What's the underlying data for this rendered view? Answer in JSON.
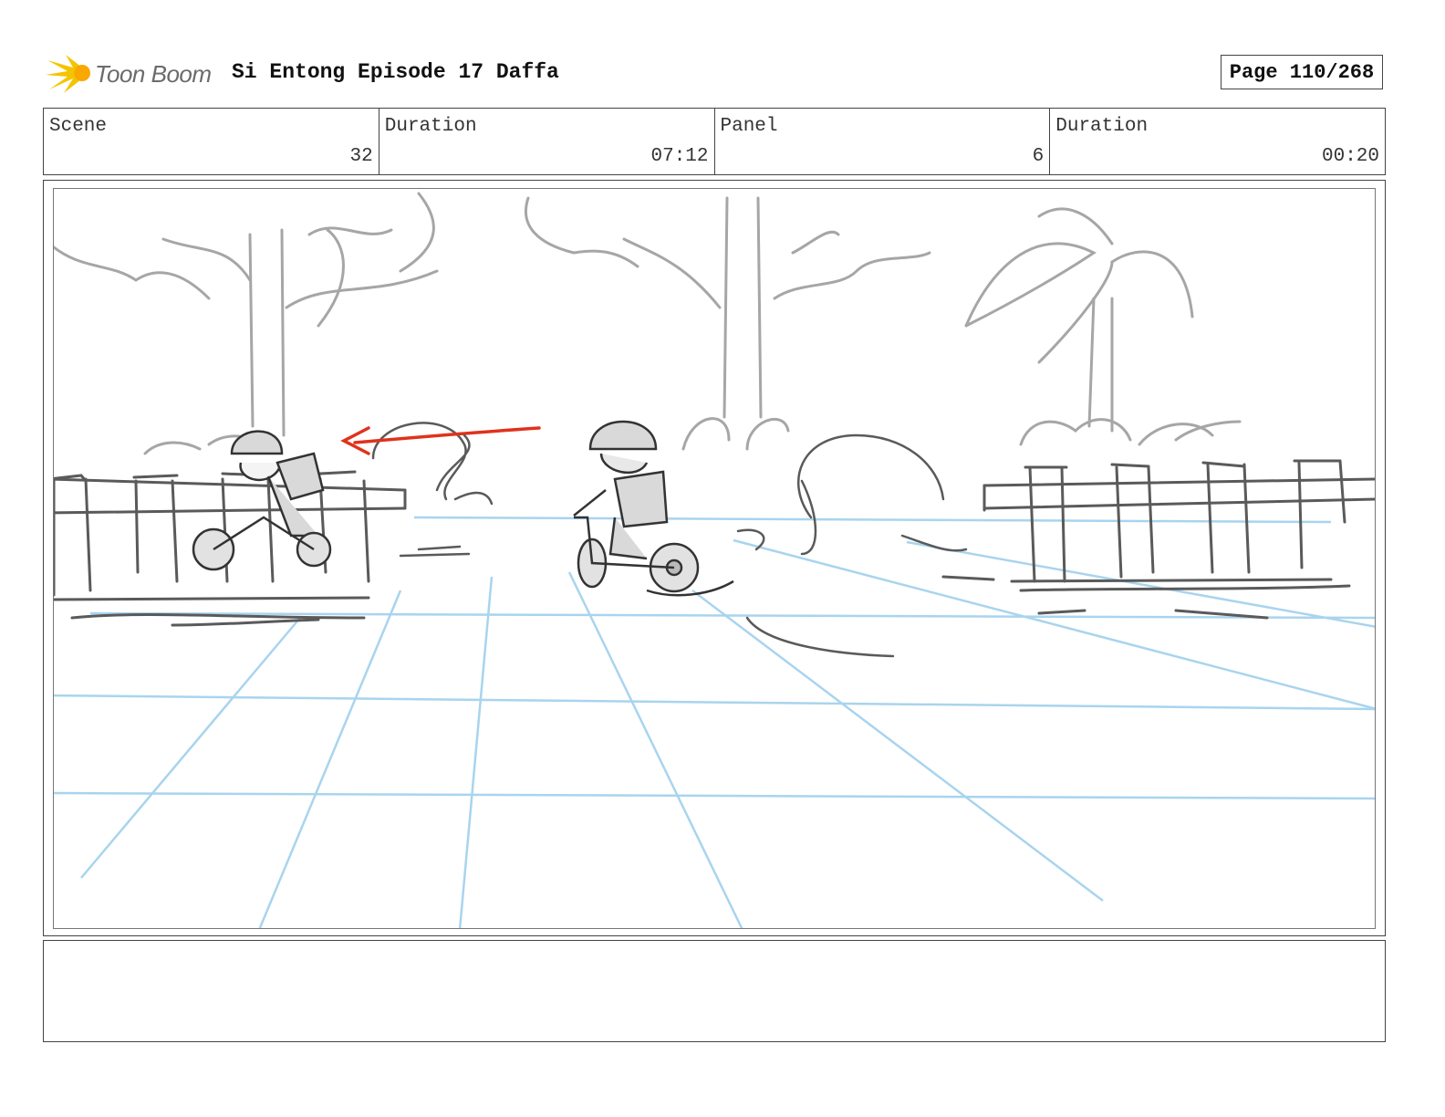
{
  "header": {
    "logo_text": "Toon Boom",
    "title": "Si Entong Episode 17 Daffa",
    "page": "Page 110/268"
  },
  "info": {
    "scene_label": "Scene",
    "scene_value": "32",
    "scene_duration_label": "Duration",
    "scene_duration_value": "07:12",
    "panel_label": "Panel",
    "panel_value": "6",
    "panel_duration_label": "Duration",
    "panel_duration_value": "00:20"
  },
  "notes": {
    "text": ""
  },
  "colors": {
    "logo_accent": "#f5c400",
    "sketch_gray": "#9a9a9a",
    "sketch_dark": "#555555",
    "guide_blue": "#a9d4ee",
    "motion_arrow": "#e0321c"
  },
  "icons": {
    "logo": "toon-boom-star-icon",
    "motion": "motion-arrow-icon"
  }
}
